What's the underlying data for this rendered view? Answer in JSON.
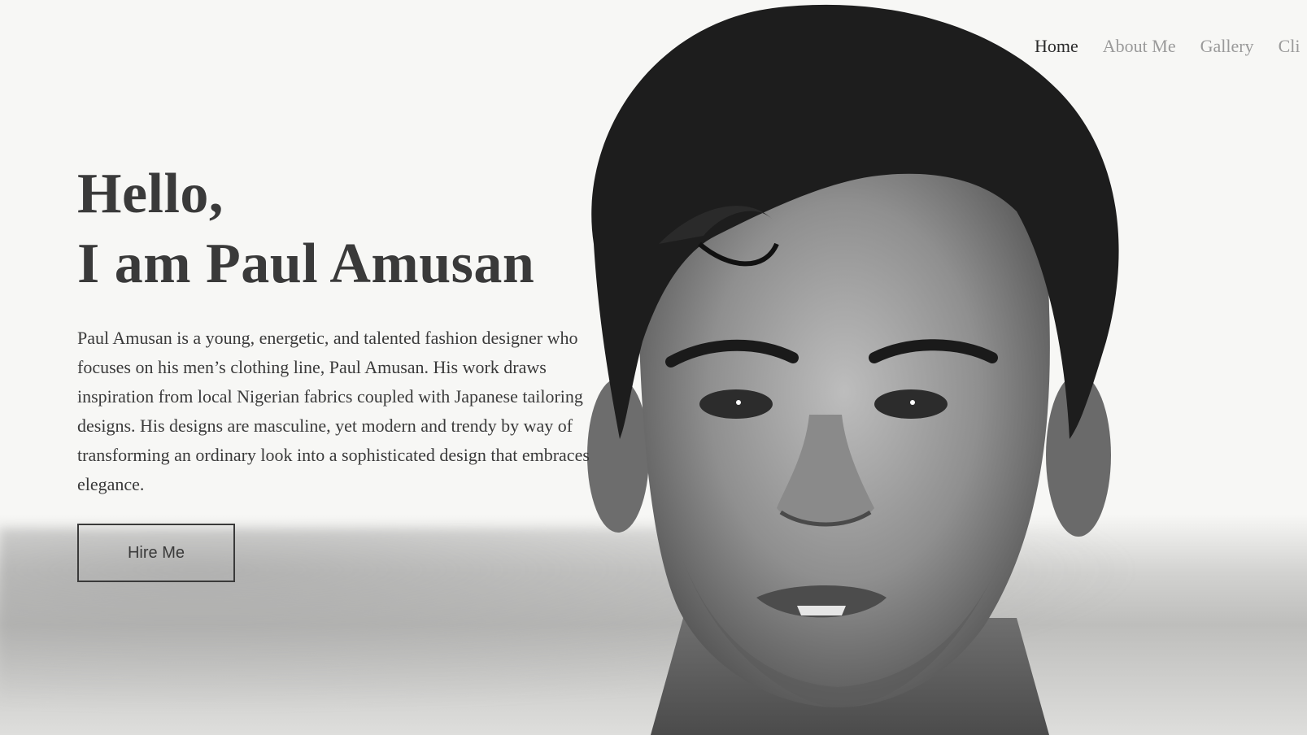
{
  "nav": {
    "items": [
      {
        "label": "Home",
        "active": true
      },
      {
        "label": "About Me",
        "active": false
      },
      {
        "label": "Gallery",
        "active": false
      },
      {
        "label": "Cli",
        "active": false
      }
    ]
  },
  "hero": {
    "greeting": "Hello,",
    "name_line": "I am Paul Amusan",
    "description": "Paul Amusan is a young, energetic, and talented fashion designer who focuses on his men’s clothing line, Paul Amusan. His work draws inspiration from local Nigerian fabrics coupled with Japanese tailoring designs. His designs are masculine, yet modern and trendy by way of transforming an ordinary look into a sophisticated design that embraces elegance.",
    "cta_label": "Hire Me"
  },
  "colors": {
    "background": "#f7f7f5",
    "text": "#3a3a3a",
    "nav_inactive": "#9a9a9a",
    "nav_active": "#2b2b2b"
  }
}
